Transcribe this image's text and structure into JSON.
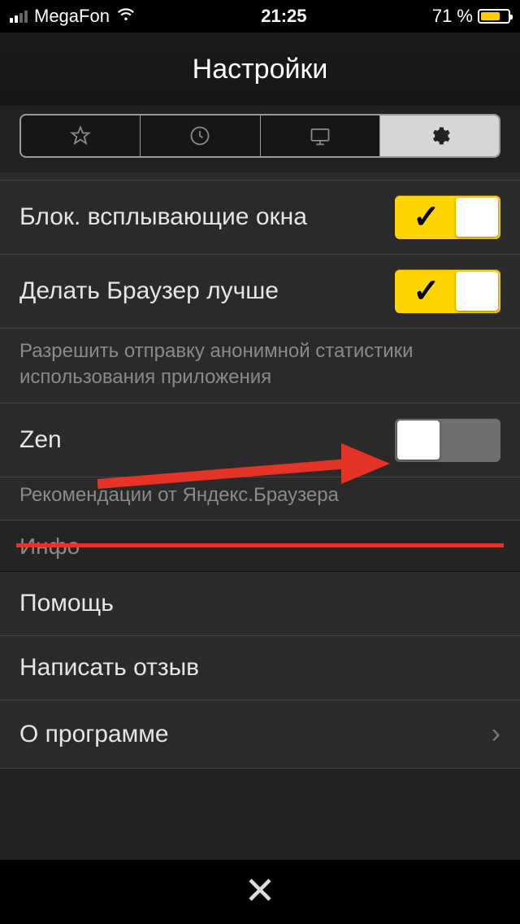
{
  "status_bar": {
    "carrier": "MegaFon",
    "time": "21:25",
    "battery_text": "71 %"
  },
  "header": {
    "title": "Настройки"
  },
  "tabs": {
    "items": [
      "star",
      "clock",
      "monitor",
      "gear"
    ],
    "active_index": 3
  },
  "rows": {
    "block_popups": {
      "label": "Блок. всплывающие окна",
      "on": true
    },
    "improve_browser": {
      "label": "Делать Браузер лучше",
      "on": true
    },
    "improve_desc": "Разрешить отправку анонимной статистики использования приложения",
    "zen": {
      "label": "Zen",
      "on": false
    },
    "zen_desc": "Рекомендации от Яндекс.Браузера"
  },
  "section": {
    "info_header": "Инфо",
    "help": "Помощь",
    "feedback": "Написать отзыв",
    "about": "О программе"
  },
  "colors": {
    "accent": "#ffd500",
    "arrow": "#e53427"
  }
}
